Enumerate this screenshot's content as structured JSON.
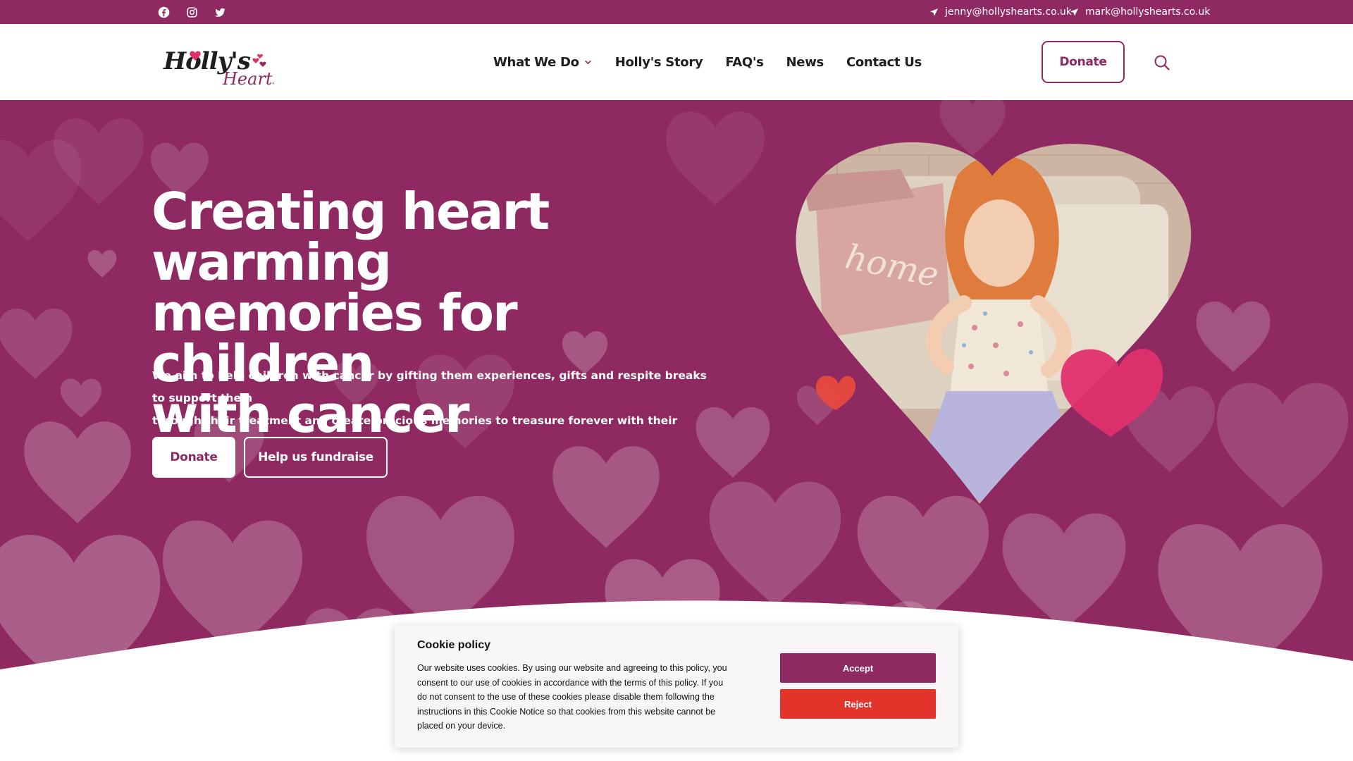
{
  "brand": {
    "logo_text_1": "Holly's",
    "logo_text_2": "Hearts",
    "primary": "#8e2a61",
    "accent_pink": "#e0306e",
    "reject_red": "#e2342a"
  },
  "topbar": {
    "social": [
      {
        "name": "facebook",
        "icon": "facebook-icon"
      },
      {
        "name": "instagram",
        "icon": "instagram-icon"
      },
      {
        "name": "twitter",
        "icon": "twitter-icon"
      }
    ],
    "emails": [
      "jenny@hollyshearts.co.uk",
      "mark@hollyshearts.co.uk"
    ]
  },
  "nav": {
    "items": [
      "What We Do",
      "Holly's Story",
      "FAQ's",
      "News",
      "Contact Us"
    ],
    "donate_label": "Donate",
    "search_icon": "search-icon"
  },
  "hero": {
    "title_lines": [
      "Creating heart warming",
      "memories for children",
      "with cancer"
    ],
    "text_lines": [
      "We aim to help children with cancer by gifting them experiences, gifts and respite breaks to support them",
      "through their treatment and create precious memories to treasure forever with their families."
    ],
    "donate_label": "Donate",
    "fundraise_label": "Help us fundraise"
  },
  "cookie": {
    "title": "Cookie policy",
    "lines": [
      "Our website uses cookies. By using our website and agreeing to this policy, you",
      "consent to our use of cookies in accordance with the terms of this policy. If you",
      "do not consent to the use of these cookies please disable them following the",
      "instructions in this Cookie Notice so that cookies from this website cannot be",
      "placed on your device."
    ],
    "accept_label": "Accept",
    "reject_label": "Reject"
  }
}
